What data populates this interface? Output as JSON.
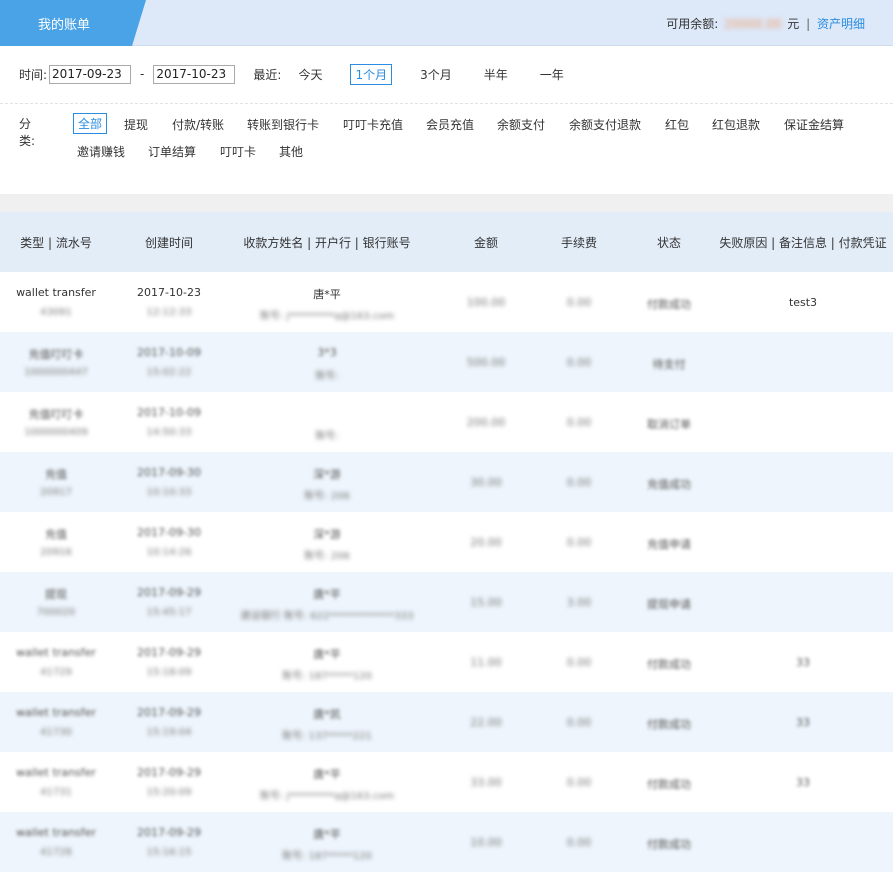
{
  "header": {
    "tab_title": "我的账单",
    "balance_label": "可用余额:",
    "balance_amount": "20000.00",
    "balance_unit": "元",
    "separator": "|",
    "asset_link": "资产明细"
  },
  "filters": {
    "time_label": "时间:",
    "date_from": "2017-09-23",
    "date_sep": "-",
    "date_to": "2017-10-23",
    "recent_label": "最近:",
    "ranges": [
      "今天",
      "1个月",
      "3个月",
      "半年",
      "一年"
    ],
    "active_range": "1个月",
    "category_label": "分类:",
    "categories": [
      "全部",
      "提现",
      "付款/转账",
      "转账到银行卡",
      "叮叮卡充值",
      "会员充值",
      "余额支付",
      "余额支付退款",
      "红包",
      "红包退款",
      "保证金结算",
      "邀请赚钱",
      "订单结算",
      "叮叮卡",
      "其他"
    ],
    "active_category": "全部"
  },
  "table": {
    "columns": [
      "类型 | 流水号",
      "创建时间",
      "收款方姓名 | 开户行 | 银行账号",
      "金额",
      "手续费",
      "状态",
      "失败原因 | 备注信息 | 付款凭证"
    ],
    "rows": [
      {
        "type": "wallet transfer",
        "serial": "43091",
        "date": "2017-10-23",
        "time": "12:12:33",
        "name": "唐*平",
        "account": "账号: j*********q@163.com",
        "amount": "100.00",
        "fee": "0.00",
        "status": "付款成功",
        "note": "test3"
      },
      {
        "type": "充值叮叮卡",
        "serial": "1000000447",
        "date": "2017-10-09",
        "time": "15:02:22",
        "name": "3*3",
        "account": "账号:",
        "amount": "500.00",
        "fee": "0.00",
        "status": "待支付",
        "note": ""
      },
      {
        "type": "充值叮叮卡",
        "serial": "1000000409",
        "date": "2017-10-09",
        "time": "14:50:33",
        "name": "",
        "account": "账号:",
        "amount": "200.00",
        "fee": "0.00",
        "status": "取消订单",
        "note": ""
      },
      {
        "type": "充值",
        "serial": "20917",
        "date": "2017-09-30",
        "time": "10:10:33",
        "name": "深*游",
        "account": "账号: 206",
        "amount": "30.00",
        "fee": "0.00",
        "status": "充值成功",
        "note": ""
      },
      {
        "type": "充值",
        "serial": "20916",
        "date": "2017-09-30",
        "time": "10:14:26",
        "name": "深*游",
        "account": "账号: 206",
        "amount": "20.00",
        "fee": "0.00",
        "status": "充值申请",
        "note": ""
      },
      {
        "type": "提现",
        "serial": "700020",
        "date": "2017-09-29",
        "time": "15:45:17",
        "name": "唐*平",
        "account": "建设银行 账号: 622*************333",
        "amount": "15.00",
        "fee": "3.00",
        "status": "提现申请",
        "note": ""
      },
      {
        "type": "wallet transfer",
        "serial": "41729",
        "date": "2017-09-29",
        "time": "15:18:09",
        "name": "唐*平",
        "account": "账号: 187*****120",
        "amount": "11.00",
        "fee": "0.00",
        "status": "付款成功",
        "note": "33"
      },
      {
        "type": "wallet transfer",
        "serial": "41730",
        "date": "2017-09-29",
        "time": "15:19:04",
        "name": "唐*凯",
        "account": "账号: 137*****221",
        "amount": "22.00",
        "fee": "0.00",
        "status": "付款成功",
        "note": "33"
      },
      {
        "type": "wallet transfer",
        "serial": "41731",
        "date": "2017-09-29",
        "time": "15:20:09",
        "name": "唐*平",
        "account": "账号: j*********q@163.com",
        "amount": "33.00",
        "fee": "0.00",
        "status": "付款成功",
        "note": "33"
      },
      {
        "type": "wallet transfer",
        "serial": "41728",
        "date": "2017-09-29",
        "time": "15:16:15",
        "name": "唐*平",
        "account": "账号: 187*****120",
        "amount": "10.00",
        "fee": "0.00",
        "status": "付款成功",
        "note": ""
      }
    ]
  }
}
